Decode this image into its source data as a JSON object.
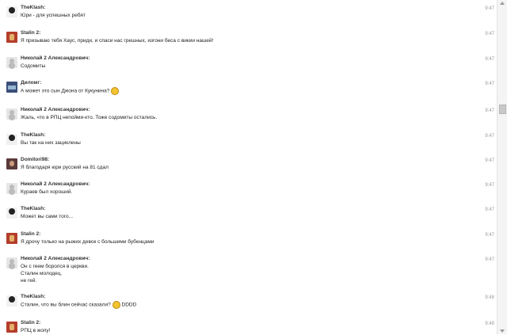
{
  "messages": [
    {
      "author": "TheKlash:",
      "lines": [
        "Юри - для успешных ребят"
      ],
      "time": "9:47",
      "avatar": "klash-avatar"
    },
    {
      "author": "Stalin 2:",
      "lines": [
        "Я призываю тебя Хаус, приди, и спаси нас грешных, изгони беса с викии нашей!"
      ],
      "time": "9:47",
      "avatar": "stalin-avatar"
    },
    {
      "author": "Николай 2 Александрович:",
      "lines": [
        "Содомиты"
      ],
      "time": "9:47",
      "avatar": "default-avatar"
    },
    {
      "author": "Диломг:",
      "lines": [
        "А может это сын Джона от Кукунина?"
      ],
      "time": "9:47",
      "avatar": "dilomg-avatar"
    },
    {
      "author": "Николай 2 Александрович:",
      "lines": [
        "Жаль, что в РПЦ непойми-кто. Тоже содомиты остались."
      ],
      "time": "9:47",
      "avatar": "default-avatar"
    },
    {
      "author": "TheKlash:",
      "lines": [
        "Вы так на них зациклены"
      ],
      "time": "9:47",
      "avatar": "klash-avatar"
    },
    {
      "author": "Domitori98:",
      "lines": [
        "Я благодаря юри русский на 81 сдал"
      ],
      "time": "9:47",
      "avatar": "domitori-avatar"
    },
    {
      "author": "Николай 2 Александрович:",
      "lines": [
        "Кураев был хороший."
      ],
      "time": "9:47",
      "avatar": "default-avatar"
    },
    {
      "author": "TheKlash:",
      "lines": [
        "Может вы сами того..."
      ],
      "time": "9:47",
      "avatar": "klash-avatar"
    },
    {
      "author": "Stalin 2:",
      "lines": [
        "Я дрочу только на рыжих девок с большими бубенцами"
      ],
      "time": "9:47",
      "avatar": "stalin-avatar"
    },
    {
      "author": "Николай 2 Александрович:",
      "lines": [
        "Он с геем боролся в церкви.",
        "Сталин молодец.",
        "не гей."
      ],
      "time": "9:47",
      "avatar": "default-avatar"
    },
    {
      "author": "TheKlash:",
      "lines": [
        "Сталин, что вы блин сейчас сказали?"
      ],
      "suffix": "DDDD",
      "time": "9:48",
      "avatar": "klash-avatar"
    },
    {
      "author": "Stalin 2:",
      "lines": [
        "РПЦ в жопу!"
      ],
      "time": "9:48",
      "avatar": "stalin-avatar"
    }
  ]
}
